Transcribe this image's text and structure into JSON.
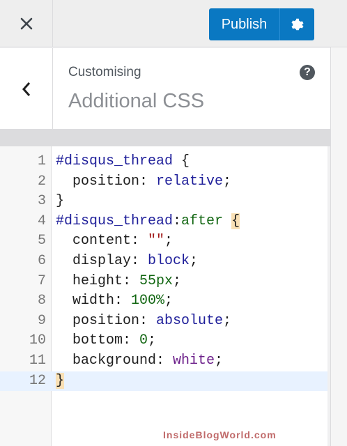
{
  "topbar": {
    "publish_label": "Publish",
    "icons": {
      "close": "close-icon",
      "gear": "gear-icon"
    }
  },
  "header": {
    "context": "Customising",
    "title": "Additional CSS",
    "help_icon": "?"
  },
  "editor": {
    "lines": [
      {
        "n": "1",
        "parts": [
          [
            "sel",
            "#disqus_thread"
          ],
          [
            "plain",
            " {"
          ]
        ]
      },
      {
        "n": "2",
        "parts": [
          [
            "plain",
            "  position: "
          ],
          [
            "kw",
            "relative"
          ],
          [
            "plain",
            ";"
          ]
        ]
      },
      {
        "n": "3",
        "parts": [
          [
            "plain",
            "}"
          ]
        ]
      },
      {
        "n": "4",
        "parts": [
          [
            "sel",
            "#disqus_thread"
          ],
          [
            "plain",
            ":"
          ],
          [
            "pseudo",
            "after"
          ],
          [
            "plain",
            " "
          ],
          [
            "hl",
            "{"
          ]
        ]
      },
      {
        "n": "5",
        "parts": [
          [
            "plain",
            "  content: "
          ],
          [
            "str",
            "\"\""
          ],
          [
            "plain",
            ";"
          ]
        ]
      },
      {
        "n": "6",
        "parts": [
          [
            "plain",
            "  display: "
          ],
          [
            "kw",
            "block"
          ],
          [
            "plain",
            ";"
          ]
        ]
      },
      {
        "n": "7",
        "parts": [
          [
            "plain",
            "  height: "
          ],
          [
            "num",
            "55px"
          ],
          [
            "plain",
            ";"
          ]
        ]
      },
      {
        "n": "8",
        "parts": [
          [
            "plain",
            "  width: "
          ],
          [
            "num",
            "100%"
          ],
          [
            "plain",
            ";"
          ]
        ]
      },
      {
        "n": "9",
        "parts": [
          [
            "plain",
            "  position: "
          ],
          [
            "kw",
            "absolute"
          ],
          [
            "plain",
            ";"
          ]
        ]
      },
      {
        "n": "10",
        "parts": [
          [
            "plain",
            "  bottom: "
          ],
          [
            "num",
            "0"
          ],
          [
            "plain",
            ";"
          ]
        ]
      },
      {
        "n": "11",
        "parts": [
          [
            "plain",
            "  background: "
          ],
          [
            "white",
            "white"
          ],
          [
            "plain",
            ";"
          ]
        ]
      },
      {
        "n": "12",
        "parts": [
          [
            "hl",
            "}"
          ]
        ]
      }
    ],
    "active_line": "12"
  },
  "watermark": "InsideBlogWorld.com",
  "colors": {
    "accent": "#0a78c2",
    "active_line": "#e8f2ff"
  }
}
